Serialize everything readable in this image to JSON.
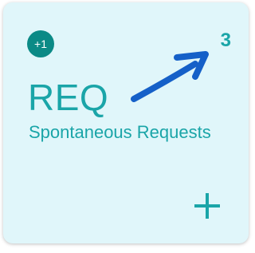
{
  "tile": {
    "badge": "+1",
    "count": "3",
    "title": "REQ",
    "subtitle": "Spontaneous Requests"
  },
  "icons": {
    "add": "plus-icon",
    "annotation": "arrow-annotation"
  },
  "colors": {
    "tile_bg": "#e0f6fa",
    "teal_text": "#1aa5a8",
    "badge_bg": "#0b8a86",
    "arrow": "#1560c8"
  }
}
